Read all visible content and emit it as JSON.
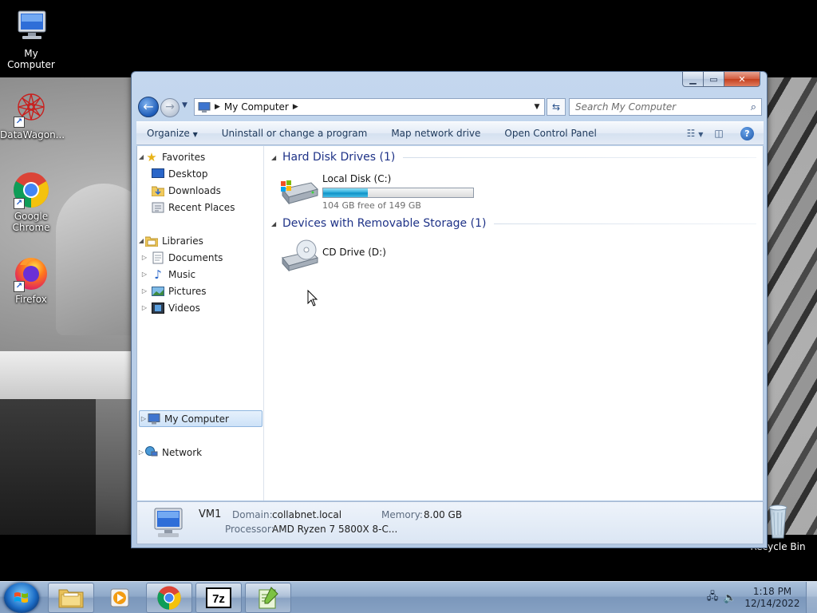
{
  "desktop": {
    "icons": [
      {
        "label": "My Computer",
        "icon": "computer-icon"
      },
      {
        "label": "DataWagon...",
        "icon": "datawagon-icon"
      },
      {
        "label": "Google Chrome",
        "icon": "chrome-icon"
      },
      {
        "label": "Firefox",
        "icon": "firefox-icon"
      },
      {
        "label": "Recycle Bin",
        "icon": "recycle-bin-icon"
      }
    ]
  },
  "window": {
    "address": {
      "location": "My Computer"
    },
    "search": {
      "placeholder": "Search My Computer"
    },
    "toolbar": {
      "organize": "Organize",
      "uninstall": "Uninstall or change a program",
      "map_drive": "Map network drive",
      "control_panel": "Open Control Panel"
    },
    "nav": {
      "favorites": "Favorites",
      "desktop": "Desktop",
      "downloads": "Downloads",
      "recent_places": "Recent Places",
      "libraries": "Libraries",
      "documents": "Documents",
      "music": "Music",
      "pictures": "Pictures",
      "videos": "Videos",
      "my_computer": "My Computer",
      "network": "Network"
    },
    "groups": {
      "hard_disks": "Hard Disk Drives (1)",
      "removable": "Devices with Removable Storage (1)"
    },
    "drives": {
      "c": {
        "name": "Local Disk (C:)",
        "free": "104 GB free of 149 GB",
        "used_fraction": 0.3
      },
      "d": {
        "name": "CD Drive (D:)"
      }
    },
    "details": {
      "name": "VM1",
      "domain_label": "Domain:",
      "domain": "collabnet.local",
      "memory_label": "Memory:",
      "memory": "8.00 GB",
      "processor_label": "Processor:",
      "processor": "AMD Ryzen 7 5800X 8-C..."
    }
  },
  "taskbar": {
    "clock_time": "1:18 PM",
    "clock_date": "12/14/2022",
    "pinned": [
      "explorer-icon",
      "media-player-icon",
      "chrome-icon",
      "7zip-icon",
      "notepad-plus-icon"
    ]
  },
  "colors": {
    "accent": "#1e3287",
    "selection": "#cde2f8",
    "progress": "#26a8d8",
    "close": "#c4401f"
  }
}
